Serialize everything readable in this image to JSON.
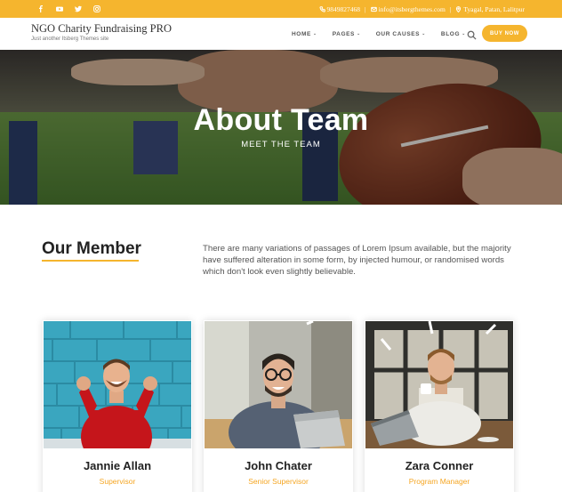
{
  "topbar": {
    "social": [
      "facebook-icon",
      "youtube-icon",
      "twitter-icon",
      "instagram-icon"
    ],
    "phone": "9849827468",
    "email": "info@itsbergthemes.com",
    "address": "Tyagal, Patan, Lalitpur",
    "separator": "|",
    "accent_color": "#f5b52e"
  },
  "header": {
    "site_title": "NGO Charity Fundraising PRO",
    "tagline": "Just another Itsberg Themes site",
    "nav": [
      {
        "label": "HOME",
        "chevron": "⌄"
      },
      {
        "label": "PAGES",
        "chevron": "⌄"
      },
      {
        "label": "OUR CAUSES",
        "chevron": "⌄"
      },
      {
        "label": "BLOG",
        "chevron": "⌄"
      }
    ],
    "search_icon": "search-icon",
    "buy_label": "BUY NOW"
  },
  "hero": {
    "title": "About Team",
    "subtitle": "MEET THE TEAM"
  },
  "members": {
    "heading": "Our Member",
    "intro": "There are many variations of passages of Lorem Ipsum available, but the majority have suffered alteration in some form, by injected humour, or randomised words which don't look even slightly believable."
  },
  "team": [
    {
      "name": "Jannie Allan",
      "role": "Supervisor"
    },
    {
      "name": "John Chater",
      "role": "Senior Supervisor"
    },
    {
      "name": "Zara Conner",
      "role": "Program Manager"
    }
  ]
}
